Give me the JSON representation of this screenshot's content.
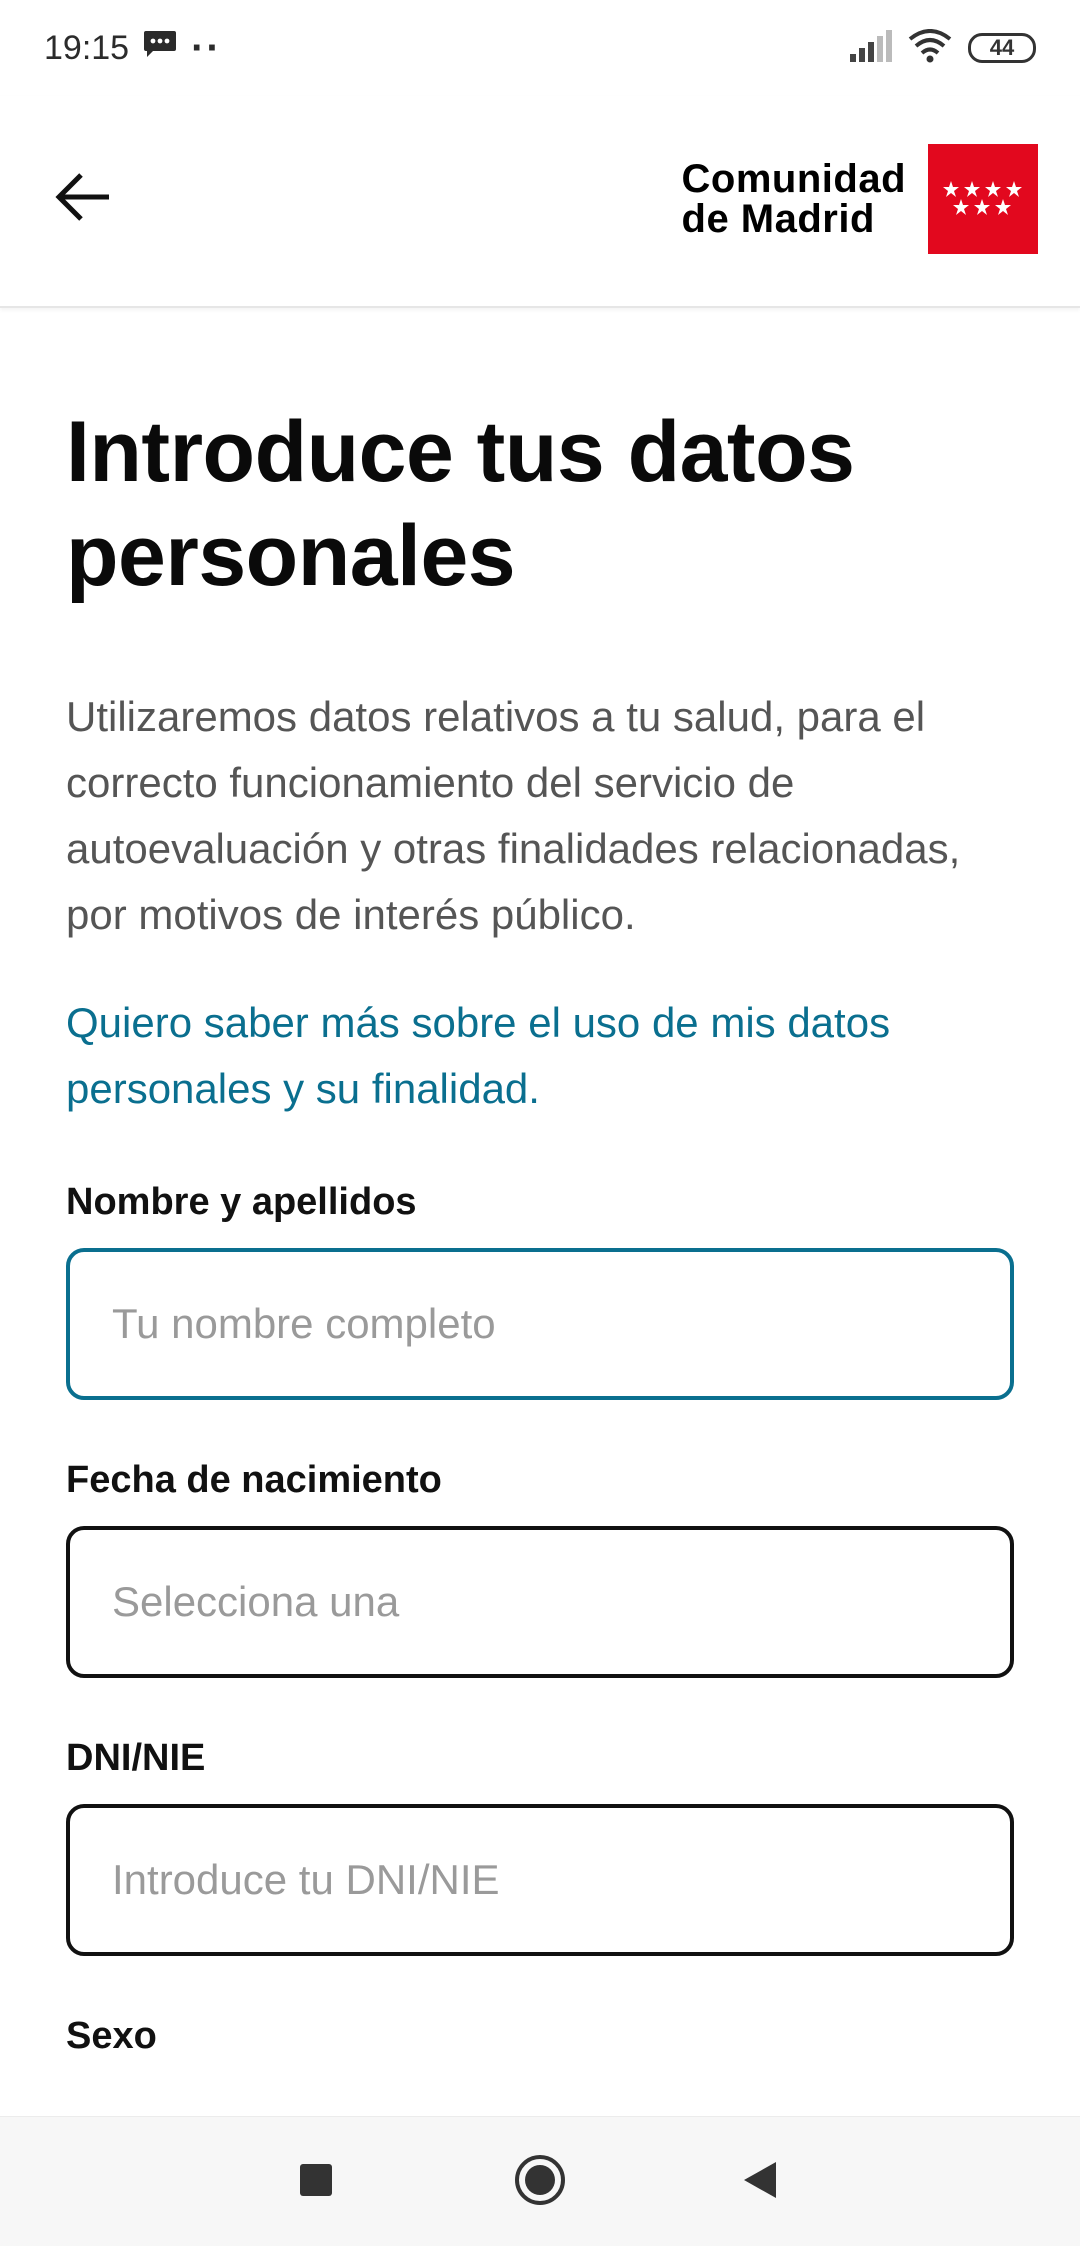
{
  "status_bar": {
    "time": "19:15",
    "dots": "··",
    "battery_level": "44",
    "icons": [
      "message-icon",
      "signal-icon",
      "wifi-icon",
      "battery-icon"
    ]
  },
  "header": {
    "back_icon": "arrow-left-icon",
    "logo_line1": "Comunidad",
    "logo_line2": "de Madrid",
    "logo_flag_color": "#e2081e"
  },
  "main": {
    "title_line1": "Introduce tus datos",
    "title_line2": "personales",
    "intro": "Utilizaremos datos relativos a tu salud, para el correcto funcionamiento del servicio de autoevaluación y otras finalidades relacionadas, por motivos de interés público.",
    "more_link": "Quiero saber más sobre el uso de mis datos personales y su finalidad."
  },
  "form": {
    "nombre": {
      "label": "Nombre y apellidos",
      "placeholder": "Tu nombre completo",
      "value": ""
    },
    "fecha": {
      "label": "Fecha de nacimiento",
      "placeholder": "Selecciona una",
      "value": ""
    },
    "dni": {
      "label": "DNI/NIE",
      "placeholder": "Introduce tu DNI/NIE",
      "value": ""
    },
    "sexo": {
      "label": "Sexo"
    }
  },
  "nav_bar": {
    "icons": [
      "recents-square-icon",
      "home-circle-icon",
      "back-triangle-icon"
    ]
  },
  "colors": {
    "accent_link": "#0a6f8f",
    "focused_border": "#0a6f8f",
    "text_primary": "#111111",
    "text_secondary": "#555555"
  }
}
